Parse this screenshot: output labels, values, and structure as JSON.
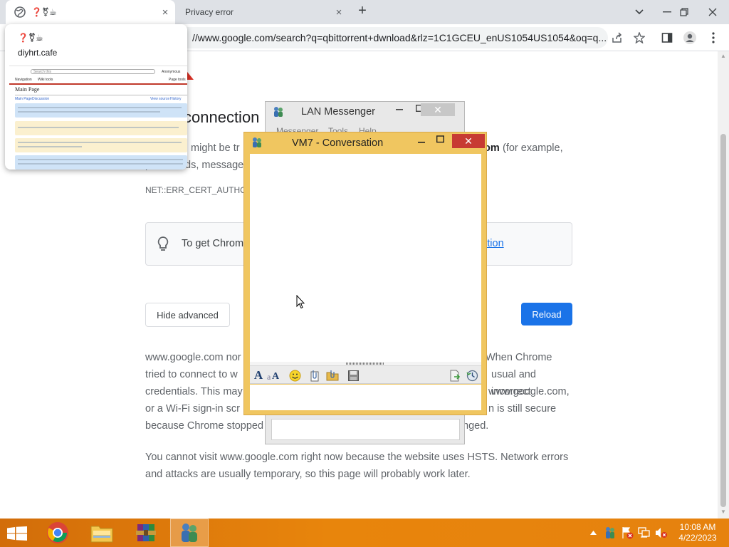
{
  "browser": {
    "tabs": [
      {
        "title": "❓⚧︎☕",
        "close": "×"
      },
      {
        "title": "Privacy error",
        "close": "×"
      }
    ],
    "new_tab_symbol": "+",
    "url": "//www.google.com/search?q=qbittorrent+dwnload&rlz=1C1GCEU_enUS1054US1054&oq=q...",
    "hover_card": {
      "title": "❓⚧︎☕",
      "domain": "diyhrt.cafe",
      "thumb": {
        "search_placeholder": "Search this",
        "navigation": "Navigation",
        "wiki_tools": "Wiki tools",
        "page_tools": "Page tools",
        "user": "Anonymous",
        "main_page": "Main Page",
        "main_page_tab": "Main Page",
        "discussion_tab": "Discussion",
        "view_source": "View source",
        "history": "History"
      }
    }
  },
  "error_page": {
    "heading": "connection",
    "para1_a": ", might be tr",
    "para1_bold": "om",
    "para1_b": " (for example,",
    "para1_c": "p",
    "para1_d": "ds, messages",
    "error_code": "NET::ERR_CERT_AUTHORIT",
    "tip_text": "To get Chrom",
    "tip_link": "ction",
    "hide_advanced": "Hide advanced",
    "reload": "Reload",
    "para2_lines": [
      [
        "www.google.com nor",
        "When Chrome"
      ],
      [
        "tried to connect to w",
        "usual and incorrect"
      ],
      [
        "credentials. This may",
        "www.google.com,"
      ],
      [
        "or a Wi-Fi sign-in scr",
        "n is still secure"
      ],
      [
        "because Chrome stopped",
        "nged."
      ]
    ],
    "para3": "You cannot visit www.google.com right now because the website uses HSTS. Network errors and attacks are usually temporary, so this page will probably work later."
  },
  "lan_messenger": {
    "title": "LAN Messenger",
    "menu": [
      "Messenger",
      "Tools",
      "Help"
    ],
    "close": "✕"
  },
  "conversation": {
    "title": "VM7 - Conversation",
    "close": "✕"
  },
  "taskbar": {
    "time": "10:08 AM",
    "date": "4/22/2023",
    "accent": "#e6820e"
  },
  "colors": {
    "chrome_blue": "#1a73e8",
    "error_red": "#d93025",
    "conversation_frame": "#f0c660",
    "close_red": "#c73a33"
  }
}
